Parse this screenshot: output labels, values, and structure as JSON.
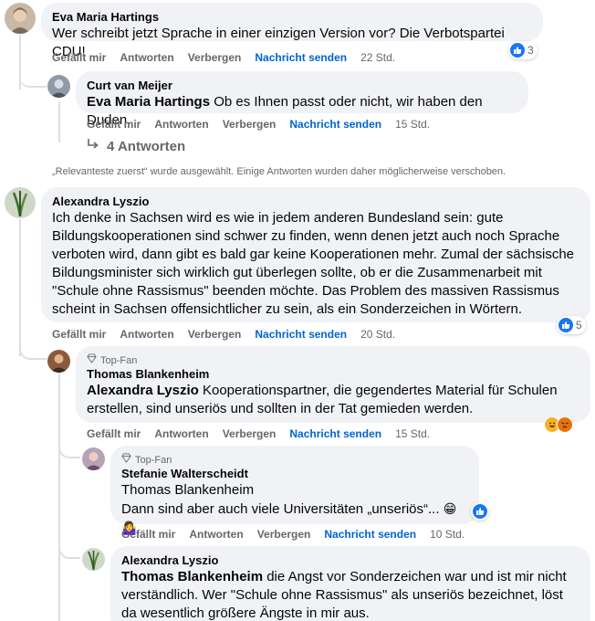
{
  "actions": {
    "like": "Gefällt mir",
    "reply": "Antworten",
    "hide": "Verbergen",
    "send": "Nachricht senden"
  },
  "topfan_label": "Top-Fan",
  "comments": {
    "c1": {
      "author": "Eva Maria Hartings",
      "text": "Wer schreibt jetzt Sprache in einer einzigen Version vor? Die Verbotspartei CDU!",
      "time": "22 Std.",
      "reactions": "3"
    },
    "c2": {
      "author": "Curt van Meijer",
      "mention": "Eva Maria Hartings",
      "text": " Ob es Ihnen passt oder nicht, wir haben den Duden.",
      "time": "15 Std."
    },
    "replies_link": "4 Antworten",
    "notice": "„Relevanteste zuerst“ wurde ausgewählt. Einige Antworten wurden daher möglicherweise verschoben.",
    "c3": {
      "author": "Alexandra Lyszio",
      "text": "Ich denke in Sachsen wird es wie in jedem anderen Bundesland sein: gute Bildungskooperationen sind schwer zu finden, wenn denen jetzt auch noch Sprache verboten wird, dann gibt es bald gar keine Kooperationen mehr. Zumal der sächsische Bildungsminister sich wirklich gut überlegen sollte, ob er die Zusammenarbeit mit \"Schule ohne Rassismus\" beenden möchte. Das Problem des massiven Rassismus scheint in Sachsen offensichtlicher zu sein, als ein Sonderzeichen in Wörtern.",
      "time": "20 Std.",
      "reactions": "5"
    },
    "c4": {
      "author": "Thomas Blankenheim",
      "mention": "Alexandra Lyszio",
      "text": " Kooperationspartner, die gegendertes Material für Schulen erstellen, sind unseriös und sollten in der Tat gemieden werden.",
      "time": "15 Std."
    },
    "c5": {
      "author": "Stefanie Walterscheidt",
      "mention": "Thomas Blankenheim",
      "text": "Dann sind aber auch viele Universitäten „unseriös“...",
      "emojis": "😁🤷‍♀️",
      "time": "10 Std."
    },
    "c6": {
      "author": "Alexandra Lyszio",
      "mention": "Thomas Blankenheim",
      "text": " die Angst vor Sonderzeichen war und ist mir nicht verständlich. Wer \"Schule ohne Rassismus\" als unseriös bezeichnet, löst da wesentlich größere Ängste in mir aus."
    }
  },
  "colors": {
    "bubble": "#f0f2f5",
    "link_blue": "#0064d1",
    "meta_gray": "#65676b",
    "like_blue": "#1877f2"
  }
}
